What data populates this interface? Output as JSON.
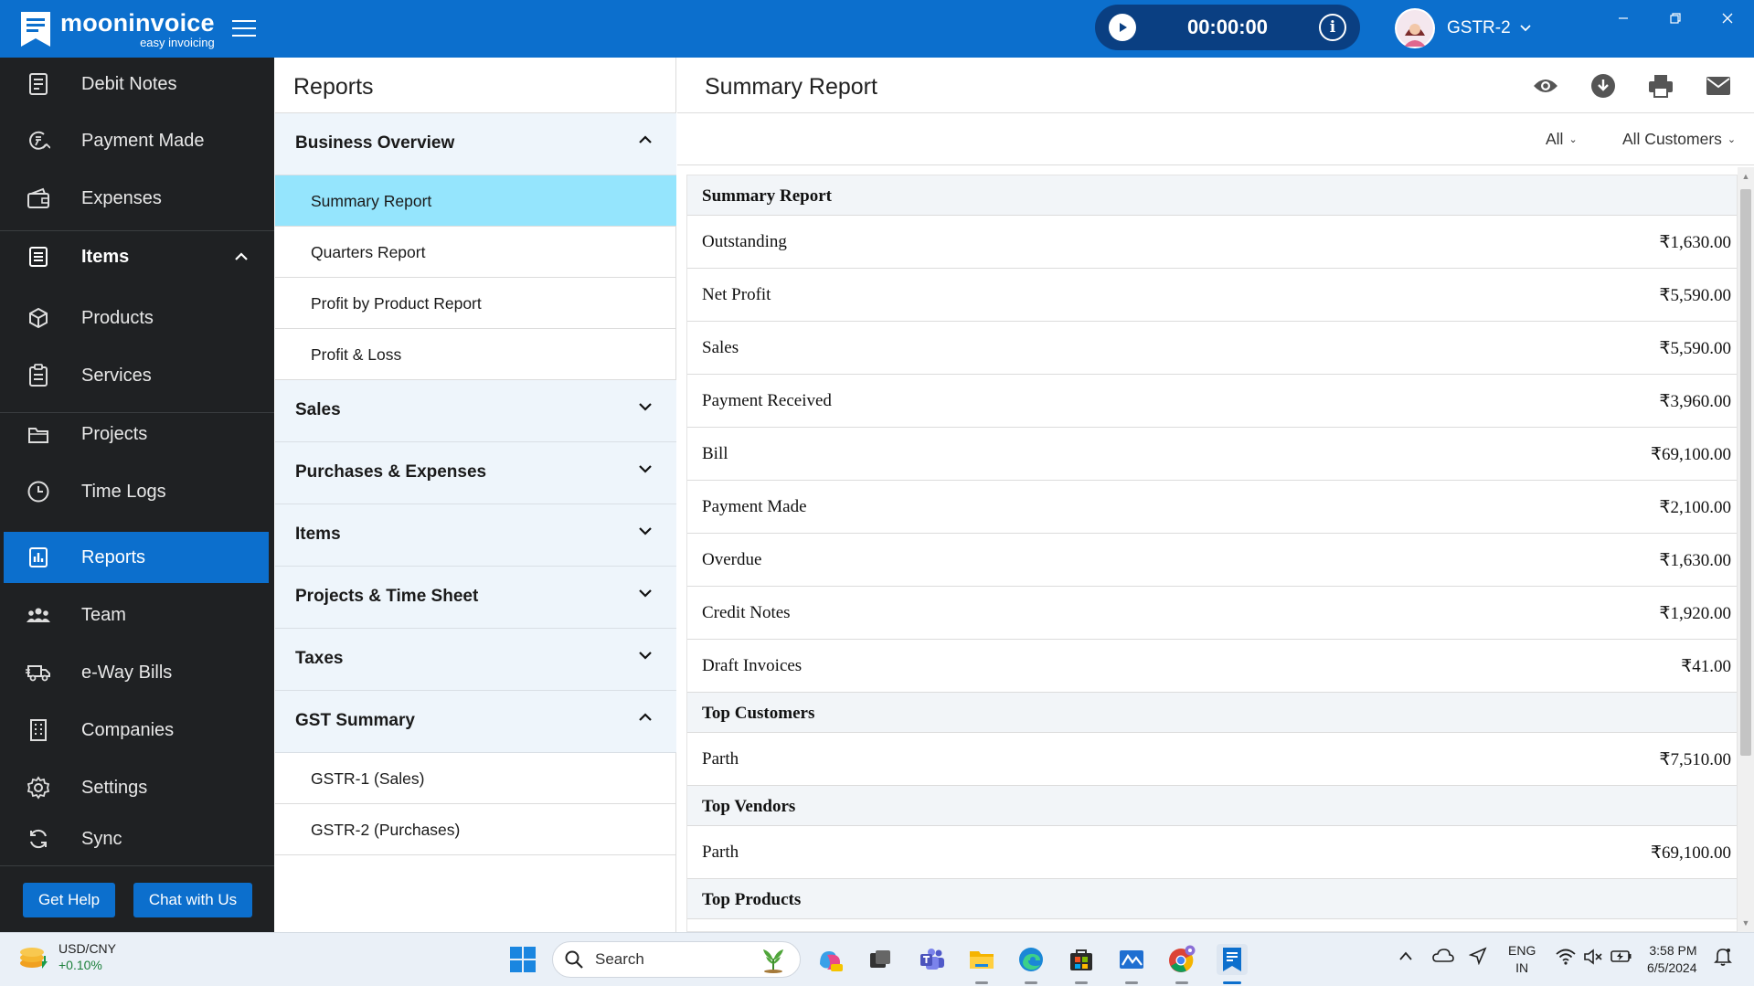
{
  "app": {
    "logo_name": "mooninvoice",
    "logo_tag": "easy invoicing",
    "timer": "00:00:00",
    "timer_info_glyph": "i",
    "company": "GSTR-2"
  },
  "colors": {
    "brand_blue": "#0c6fcd",
    "timer_bg": "#0a3f82",
    "sidebar_bg": "#1f2123",
    "selected_report_bg": "#95e5fd",
    "group_header_bg": "#eef5fb"
  },
  "sidebar": {
    "items": [
      {
        "label": "Debit Notes",
        "icon": "document-icon"
      },
      {
        "label": "Payment Made",
        "icon": "payment-icon"
      },
      {
        "label": "Expenses",
        "icon": "wallet-icon"
      },
      {
        "label": "Items",
        "icon": "list-icon"
      },
      {
        "label": "Products",
        "icon": "box-icon"
      },
      {
        "label": "Services",
        "icon": "clipboard-icon"
      },
      {
        "label": "Projects",
        "icon": "folder-icon"
      },
      {
        "label": "Time Logs",
        "icon": "clock-icon"
      },
      {
        "label": "Reports",
        "icon": "bar-chart-icon"
      },
      {
        "label": "Team",
        "icon": "team-icon"
      },
      {
        "label": "e-Way Bills",
        "icon": "truck-icon"
      },
      {
        "label": "Companies",
        "icon": "building-icon"
      },
      {
        "label": "Settings",
        "icon": "gear-icon"
      },
      {
        "label": "Sync",
        "icon": "sync-icon"
      }
    ],
    "help_label": "Get Help",
    "chat_label": "Chat with Us"
  },
  "reports_panel": {
    "title": "Reports",
    "groups": [
      {
        "label": "Business Overview",
        "expanded": true
      },
      {
        "label": "Sales",
        "expanded": false
      },
      {
        "label": "Purchases & Expenses",
        "expanded": false
      },
      {
        "label": "Items",
        "expanded": false
      },
      {
        "label": "Projects & Time Sheet",
        "expanded": false
      },
      {
        "label": "Taxes",
        "expanded": false
      },
      {
        "label": "GST Summary",
        "expanded": true
      }
    ],
    "business_overview_items": [
      "Summary Report",
      "Quarters Report",
      "Profit by Product Report",
      "Profit & Loss"
    ],
    "gst_items": [
      "GSTR-1 (Sales)",
      "GSTR-2 (Purchases)"
    ],
    "selected": "Summary Report"
  },
  "main": {
    "title": "Summary Report",
    "actions": [
      "eye-icon",
      "download-icon",
      "print-icon",
      "mail-icon"
    ],
    "filter_period": "All",
    "filter_customer": "All Customers",
    "sections": {
      "summary": "Summary Report",
      "top_customers": "Top Customers",
      "top_vendors": "Top Vendors",
      "top_products": "Top Products"
    },
    "summary_rows": [
      {
        "label": "Outstanding",
        "value": "₹1,630.00"
      },
      {
        "label": "Net Profit",
        "value": "₹5,590.00"
      },
      {
        "label": "Sales",
        "value": "₹5,590.00"
      },
      {
        "label": "Payment Received",
        "value": "₹3,960.00"
      },
      {
        "label": "Bill",
        "value": "₹69,100.00"
      },
      {
        "label": "Payment Made",
        "value": "₹2,100.00"
      },
      {
        "label": "Overdue",
        "value": "₹1,630.00"
      },
      {
        "label": "Credit Notes",
        "value": "₹1,920.00"
      },
      {
        "label": "Draft Invoices",
        "value": "₹41.00"
      }
    ],
    "top_customers": [
      {
        "label": "Parth",
        "value": "₹7,510.00"
      }
    ],
    "top_vendors": [
      {
        "label": "Parth",
        "value": "₹69,100.00"
      }
    ]
  },
  "taskbar": {
    "widget_title": "USD/CNY",
    "widget_change": "+0.10%",
    "search_label": "Search",
    "lang_top": "ENG",
    "lang_bottom": "IN",
    "time": "3:58 PM",
    "date": "6/5/2024"
  }
}
